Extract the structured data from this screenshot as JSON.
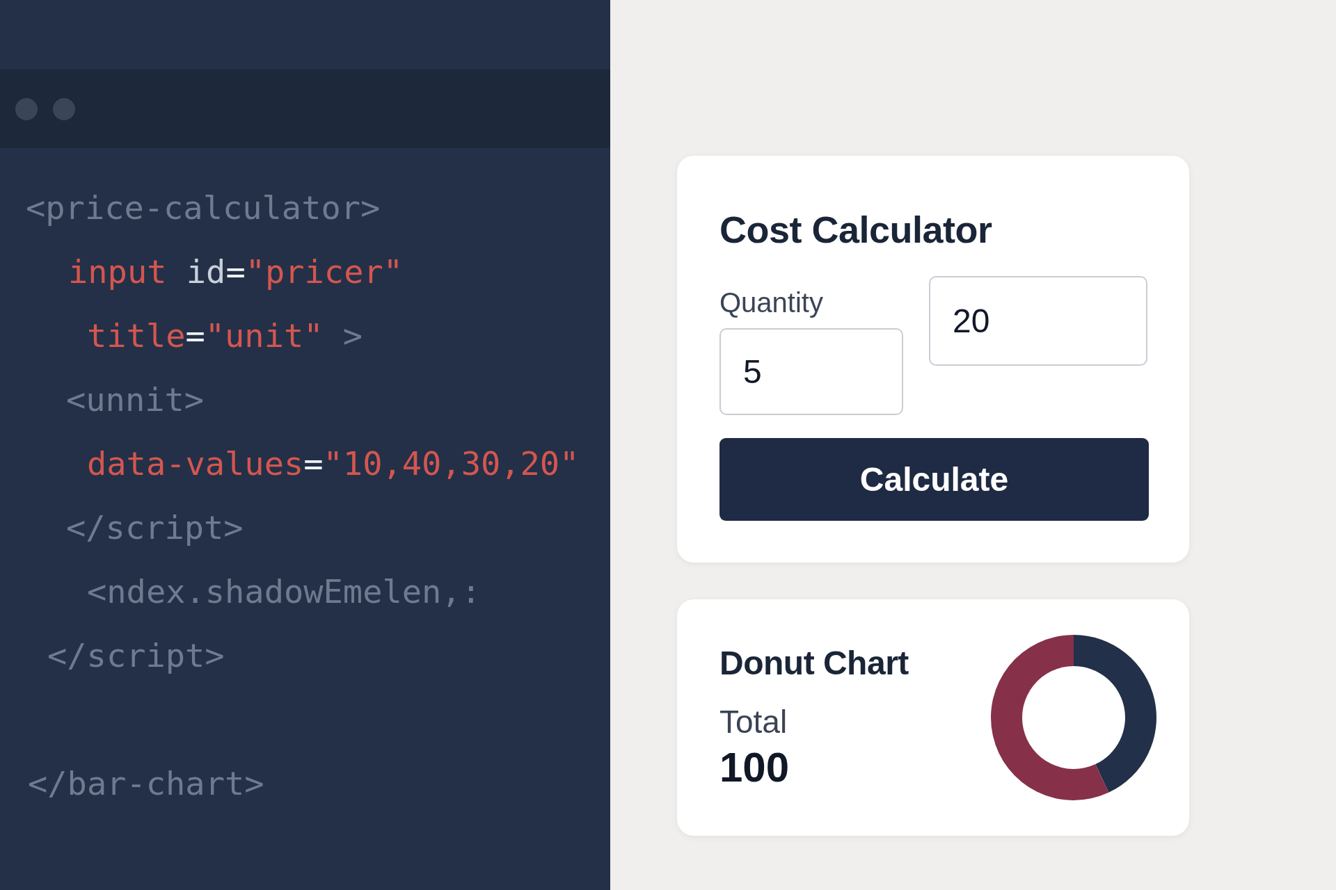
{
  "editor": {
    "code_lines": [
      {
        "segments": [
          {
            "kind": "tag",
            "text": "<price-calculator>"
          }
        ]
      },
      {
        "segments": [
          {
            "kind": "keyword",
            "text": "input"
          },
          {
            "kind": "attr",
            "text": " id"
          },
          {
            "kind": "punct",
            "text": "="
          },
          {
            "kind": "keyword",
            "text": "\"pricer\""
          }
        ]
      },
      {
        "segments": [
          {
            "kind": "keyword",
            "text": "title"
          },
          {
            "kind": "punct",
            "text": "="
          },
          {
            "kind": "keyword",
            "text": "\"unit\""
          },
          {
            "kind": "tag",
            "text": " >"
          }
        ]
      },
      {
        "segments": [
          {
            "kind": "tag",
            "text": "<unnit>"
          }
        ]
      },
      {
        "segments": [
          {
            "kind": "keyword",
            "text": "data-values"
          },
          {
            "kind": "punct",
            "text": "="
          },
          {
            "kind": "keyword",
            "text": "\"10,40,30,20\""
          }
        ]
      },
      {
        "segments": [
          {
            "kind": "tag",
            "text": "</script>"
          }
        ]
      },
      {
        "segments": [
          {
            "kind": "tag",
            "text": "<ndex.shadowEmelen,:"
          }
        ]
      },
      {
        "segments": [
          {
            "kind": "tag",
            "text": "</script>"
          }
        ]
      },
      {
        "blank_before": true,
        "segments": [
          {
            "kind": "tag",
            "text": "</bar-chart>"
          }
        ]
      }
    ]
  },
  "calculator": {
    "title": "Cost Calculator",
    "quantity_label": "Quantity",
    "quantity_value": "5",
    "unit_value": "20",
    "button": "Calculate"
  },
  "donut_card": {
    "title": "Donut Chart",
    "total_label": "Total",
    "total_value": "100"
  }
}
